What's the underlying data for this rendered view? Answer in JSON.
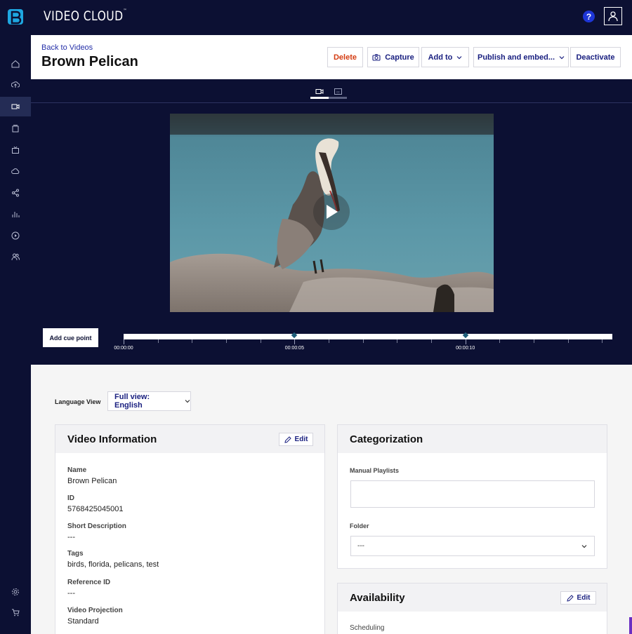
{
  "app": {
    "brand": "VIDEO CLOUD",
    "brand_mark": "™",
    "help_label": "?"
  },
  "header": {
    "back_link": "Back to Videos",
    "title": "Brown Pelican",
    "buttons": {
      "delete": "Delete",
      "capture": "Capture",
      "add_to": "Add to",
      "publish": "Publish and embed...",
      "deactivate": "Deactivate"
    }
  },
  "sidebar": {
    "items": [
      "home-icon",
      "upload-icon",
      "video-icon",
      "playlist-icon",
      "live-icon",
      "cloud-icon",
      "share-icon",
      "analytics-icon",
      "play-icon",
      "users-icon",
      "settings-icon",
      "cart-icon"
    ],
    "active": "video-icon"
  },
  "player": {
    "tabs": [
      "video-tab-icon",
      "captions-tab-icon"
    ],
    "add_cue_point": "Add cue point",
    "timeline_labels": [
      "00:00:00",
      "00:00:05",
      "00:00:10"
    ],
    "duration_seconds": 14.3,
    "cue_points_seconds": [
      5,
      10
    ]
  },
  "language": {
    "label": "Language View",
    "selected": "Full view: English"
  },
  "video_info": {
    "title": "Video Information",
    "edit": "Edit",
    "fields": [
      {
        "label": "Name",
        "value": "Brown Pelican"
      },
      {
        "label": "ID",
        "value": "5768425045001"
      },
      {
        "label": "Short Description",
        "value": "---"
      },
      {
        "label": "Tags",
        "value": "birds, florida, pelicans, test"
      },
      {
        "label": "Reference ID",
        "value": "---"
      },
      {
        "label": "Video Projection",
        "value": "Standard"
      }
    ]
  },
  "categorization": {
    "title": "Categorization",
    "manual_playlists_label": "Manual Playlists",
    "folder_label": "Folder",
    "folder_value": "---"
  },
  "availability": {
    "title": "Availability",
    "edit": "Edit",
    "scheduling_label": "Scheduling"
  },
  "colors": {
    "navy": "#0c1033",
    "link": "#2530a8",
    "delete": "#d43c12",
    "help": "#1e36d6"
  }
}
